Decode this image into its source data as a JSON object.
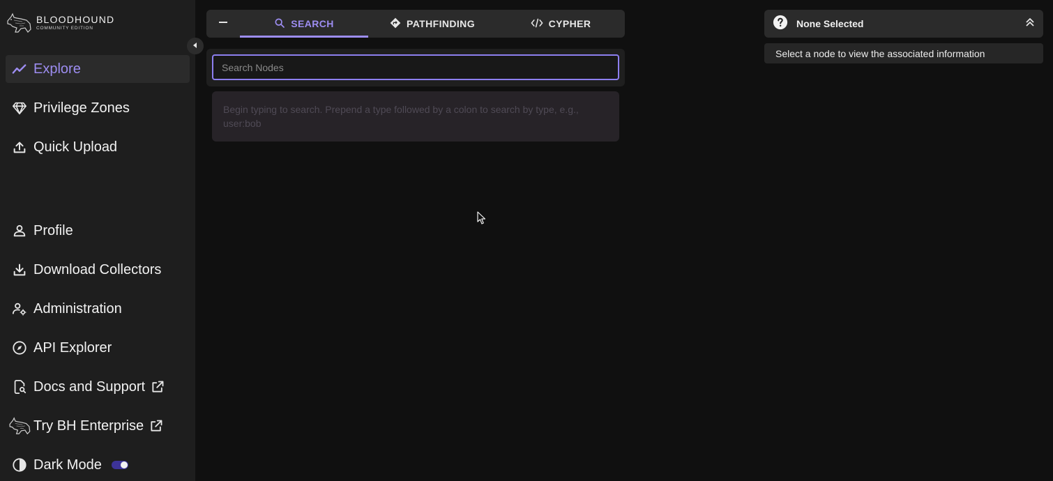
{
  "app": {
    "logo_title": "BLOODHOUND",
    "logo_subtitle": "COMMUNITY EDITION"
  },
  "sidebar": {
    "top_items": [
      {
        "label": "Explore",
        "icon": "trend-line-icon",
        "active": true
      },
      {
        "label": "Privilege Zones",
        "icon": "gem-icon"
      },
      {
        "label": "Quick Upload",
        "icon": "upload-icon"
      }
    ],
    "bottom_items": [
      {
        "label": "Profile",
        "icon": "person-icon"
      },
      {
        "label": "Download Collectors",
        "icon": "download-icon"
      },
      {
        "label": "Administration",
        "icon": "user-gear-icon"
      },
      {
        "label": "API Explorer",
        "icon": "compass-icon"
      },
      {
        "label": "Docs and Support",
        "icon": "document-search-icon",
        "external": true
      },
      {
        "label": "Try BH Enterprise",
        "icon": "bloodhound-logo-icon",
        "external": true
      },
      {
        "label": "Dark Mode",
        "icon": "contrast-icon",
        "toggle_on": true
      }
    ]
  },
  "explore_panel": {
    "tabs": [
      {
        "label": "SEARCH",
        "icon": "search-icon",
        "active": true
      },
      {
        "label": "PATHFINDING",
        "icon": "direction-icon"
      },
      {
        "label": "CYPHER",
        "icon": "code-icon"
      }
    ],
    "search_placeholder": "Search Nodes",
    "hint_text": "Begin typing to search. Prepend a type followed by a colon to search by type, e.g., user:bob"
  },
  "info_panel": {
    "title": "None Selected",
    "body": "Select a node to view the associated information"
  },
  "colors": {
    "accent": "#9d8df1",
    "sidebar_bg": "#1e1e1e",
    "page_bg": "#101010",
    "toggle_track": "#3d3399"
  }
}
